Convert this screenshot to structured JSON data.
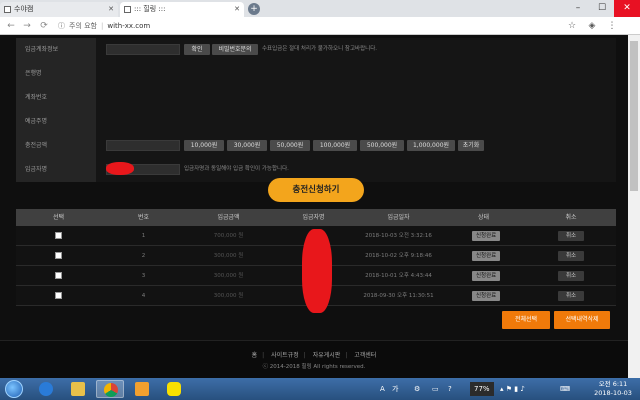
{
  "browser": {
    "tabs": [
      {
        "label": "수야캠"
      },
      {
        "label": "::: 힐링 :::"
      }
    ],
    "omnibox": {
      "security_label": "주의 요함",
      "url": "with-xx.com"
    }
  },
  "form": {
    "rows": [
      {
        "label": "입금계좌정보"
      },
      {
        "label": "은행명"
      },
      {
        "label": "계좌번호"
      },
      {
        "label": "예금주명"
      },
      {
        "label": "충전금액"
      },
      {
        "label": "입금자명"
      }
    ],
    "confirm_button": "확인",
    "password_change_button": "비밀번호문의",
    "account_note": "수표입금은 절대 처리가 불가하오니 참고바랍니다.",
    "amount_buttons": [
      "10,000원",
      "30,000원",
      "50,000원",
      "100,000원",
      "500,000원",
      "1,000,000원"
    ],
    "reset_button": "초기화",
    "depositor_note": "입금자명과 동일해야 입금 확인이 가능합니다."
  },
  "submit_button": "충전신청하기",
  "table": {
    "headers": [
      "선택",
      "번호",
      "입금금액",
      "입금자명",
      "입금일자",
      "상태",
      "취소"
    ],
    "rows": [
      {
        "no": "1",
        "amount": "700,000 원",
        "date": "2018-10-03 오전 3:32:16",
        "status": "신청완료",
        "cancel": "취소"
      },
      {
        "no": "2",
        "amount": "300,000 원",
        "date": "2018-10-02 오후 9:18:46",
        "status": "신청완료",
        "cancel": "취소"
      },
      {
        "no": "3",
        "amount": "300,000 원",
        "date": "2018-10-01 오후 4:43:44",
        "status": "신청완료",
        "cancel": "취소"
      },
      {
        "no": "4",
        "amount": "300,000 원",
        "date": "2018-09-30 오후 11:30:51",
        "status": "신청완료",
        "cancel": "취소"
      }
    ]
  },
  "actions": {
    "select_all": "전체선택",
    "delete_selected": "선택내역삭제"
  },
  "footer": {
    "links": [
      "홈",
      "사이트규정",
      "자유게시판",
      "고객센터"
    ],
    "copyright": "ⓒ 2014-2018 힐링 All rights reserved."
  },
  "taskbar": {
    "battery": "77%",
    "ime": "가",
    "time": "오전 6:11",
    "date": "2018-10-03"
  },
  "colors": {
    "accent_orange": "#f07a0a",
    "submit_yellow": "#f3a51c",
    "redaction_red": "#e8171b"
  }
}
